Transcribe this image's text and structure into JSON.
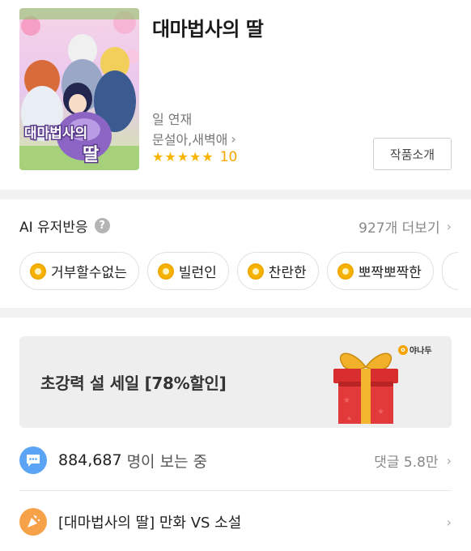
{
  "work": {
    "title": "대마법사의 딸",
    "schedule": "일 연재",
    "authors": "문설아,새벽애",
    "authors_chevron": "›",
    "stars": [
      "★",
      "★",
      "★",
      "★",
      "★"
    ],
    "score": "10",
    "intro_button": "작품소개",
    "cover_title": "대마법사의 딸"
  },
  "ai_reactions": {
    "title": "AI 유저반응",
    "help_icon": "?",
    "more": "927개 더보기",
    "chips": [
      "거부할수없는",
      "빌런인",
      "찬란한",
      "뽀짝뽀짝한"
    ]
  },
  "banner": {
    "text": "초강력 설 세일 [78%할인]",
    "brand_mark": "o",
    "brand": "야나두"
  },
  "viewers": {
    "count": "884,687",
    "suffix": "명이 보는 중",
    "comments": "댓글 5.8만"
  },
  "link": {
    "label": "[대마법사의 딸] 만화 VS 소설"
  },
  "icons": {
    "chevron": "›"
  },
  "colors": {
    "star": "#f7b500",
    "chat_icon": "#5ba4f5",
    "party_icon": "#f7a249",
    "band": "#f2f2f2"
  }
}
